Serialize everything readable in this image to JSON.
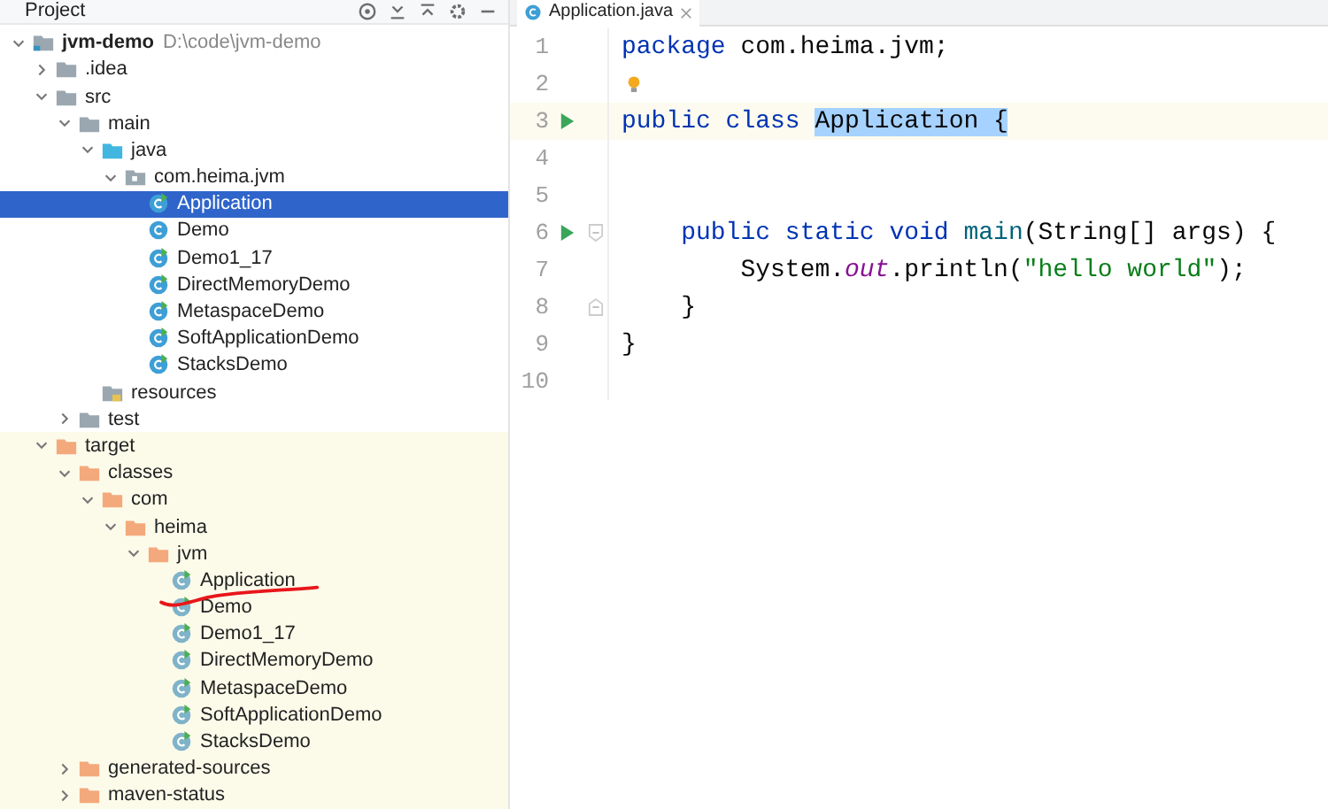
{
  "project_panel": {
    "title": "Project",
    "tree": [
      {
        "name": "jvm-demo",
        "hint": "D:\\code\\jvm-demo",
        "kind": "module",
        "expanded": true,
        "selected": false,
        "children": [
          {
            "name": ".idea",
            "kind": "folder",
            "expanded": false,
            "selected": false
          },
          {
            "name": "src",
            "kind": "folder",
            "expanded": true,
            "selected": false,
            "children": [
              {
                "name": "main",
                "kind": "folder",
                "expanded": true,
                "selected": false,
                "children": [
                  {
                    "name": "java",
                    "kind": "source-folder",
                    "expanded": true,
                    "selected": false,
                    "children": [
                      {
                        "name": "com.heima.jvm",
                        "kind": "package",
                        "expanded": true,
                        "selected": false,
                        "children": [
                          {
                            "name": "Application",
                            "kind": "runnable-class",
                            "selected": true
                          },
                          {
                            "name": "Demo",
                            "kind": "class",
                            "selected": false
                          },
                          {
                            "name": "Demo1_17",
                            "kind": "runnable-class",
                            "selected": false
                          },
                          {
                            "name": "DirectMemoryDemo",
                            "kind": "runnable-class",
                            "selected": false
                          },
                          {
                            "name": "MetaspaceDemo",
                            "kind": "runnable-class",
                            "selected": false
                          },
                          {
                            "name": "SoftApplicationDemo",
                            "kind": "runnable-class",
                            "selected": false
                          },
                          {
                            "name": "StacksDemo",
                            "kind": "runnable-class",
                            "selected": false
                          }
                        ]
                      }
                    ]
                  },
                  {
                    "name": "resources",
                    "kind": "resources-folder",
                    "selected": false
                  }
                ]
              },
              {
                "name": "test",
                "kind": "folder",
                "expanded": false,
                "selected": false
              }
            ]
          },
          {
            "name": "target",
            "kind": "excluded-folder",
            "expanded": true,
            "selected": false,
            "children": [
              {
                "name": "classes",
                "kind": "excluded-folder",
                "expanded": true,
                "selected": false,
                "children": [
                  {
                    "name": "com",
                    "kind": "excluded-folder",
                    "expanded": true,
                    "selected": false,
                    "children": [
                      {
                        "name": "heima",
                        "kind": "excluded-folder",
                        "expanded": true,
                        "selected": false,
                        "children": [
                          {
                            "name": "jvm",
                            "kind": "excluded-folder",
                            "expanded": true,
                            "selected": false,
                            "children": [
                              {
                                "name": "Application",
                                "kind": "compiled-class",
                                "selected": false
                              },
                              {
                                "name": "Demo",
                                "kind": "compiled-class",
                                "selected": false
                              },
                              {
                                "name": "Demo1_17",
                                "kind": "compiled-class",
                                "selected": false
                              },
                              {
                                "name": "DirectMemoryDemo",
                                "kind": "compiled-class",
                                "selected": false
                              },
                              {
                                "name": "MetaspaceDemo",
                                "kind": "compiled-class",
                                "selected": false
                              },
                              {
                                "name": "SoftApplicationDemo",
                                "kind": "compiled-class",
                                "selected": false
                              },
                              {
                                "name": "StacksDemo",
                                "kind": "compiled-class",
                                "selected": false
                              }
                            ]
                          }
                        ]
                      }
                    ]
                  }
                ]
              },
              {
                "name": "generated-sources",
                "kind": "excluded-folder",
                "expanded": false,
                "selected": false
              },
              {
                "name": "maven-status",
                "kind": "excluded-folder",
                "expanded": false,
                "selected": false
              }
            ]
          }
        ]
      }
    ]
  },
  "editor": {
    "tab": {
      "label": "Application.java",
      "selected": true
    },
    "lines": [
      {
        "number": "1",
        "current": false,
        "run": false,
        "tokens": [
          {
            "text": "package",
            "kind": "keyword"
          },
          {
            "text": " com.heima.jvm;",
            "kind": "plain"
          }
        ]
      },
      {
        "number": "2",
        "current": false,
        "run": false,
        "bulb": true
      },
      {
        "number": "3",
        "current": true,
        "run": true,
        "tokens": [
          {
            "text": "public class ",
            "kind": "keyword"
          },
          {
            "text": "Application {",
            "kind": "highlighted"
          }
        ]
      },
      {
        "number": "4",
        "current": false,
        "run": false
      },
      {
        "number": "5",
        "current": false,
        "run": false
      },
      {
        "number": "6",
        "current": false,
        "run": true,
        "fold_start": true,
        "tokens": [
          {
            "text": "    public static void ",
            "kind": "keyword"
          },
          {
            "text": "main",
            "kind": "method"
          },
          {
            "text": "(String[] args) {",
            "kind": "plain"
          }
        ]
      },
      {
        "number": "7",
        "current": false,
        "run": false,
        "tokens": [
          {
            "text": "        System.",
            "kind": "plain"
          },
          {
            "text": "out",
            "kind": "field"
          },
          {
            "text": ".println(",
            "kind": "plain"
          },
          {
            "text": "\"hello world\"",
            "kind": "string"
          },
          {
            "text": ");",
            "kind": "plain"
          }
        ]
      },
      {
        "number": "8",
        "current": false,
        "run": false,
        "fold_end": true,
        "tokens": [
          {
            "text": "    }",
            "kind": "plain"
          }
        ]
      },
      {
        "number": "9",
        "current": false,
        "run": false,
        "tokens": [
          {
            "text": "}",
            "kind": "plain"
          }
        ]
      },
      {
        "number": "10",
        "current": false,
        "run": false
      }
    ]
  }
}
